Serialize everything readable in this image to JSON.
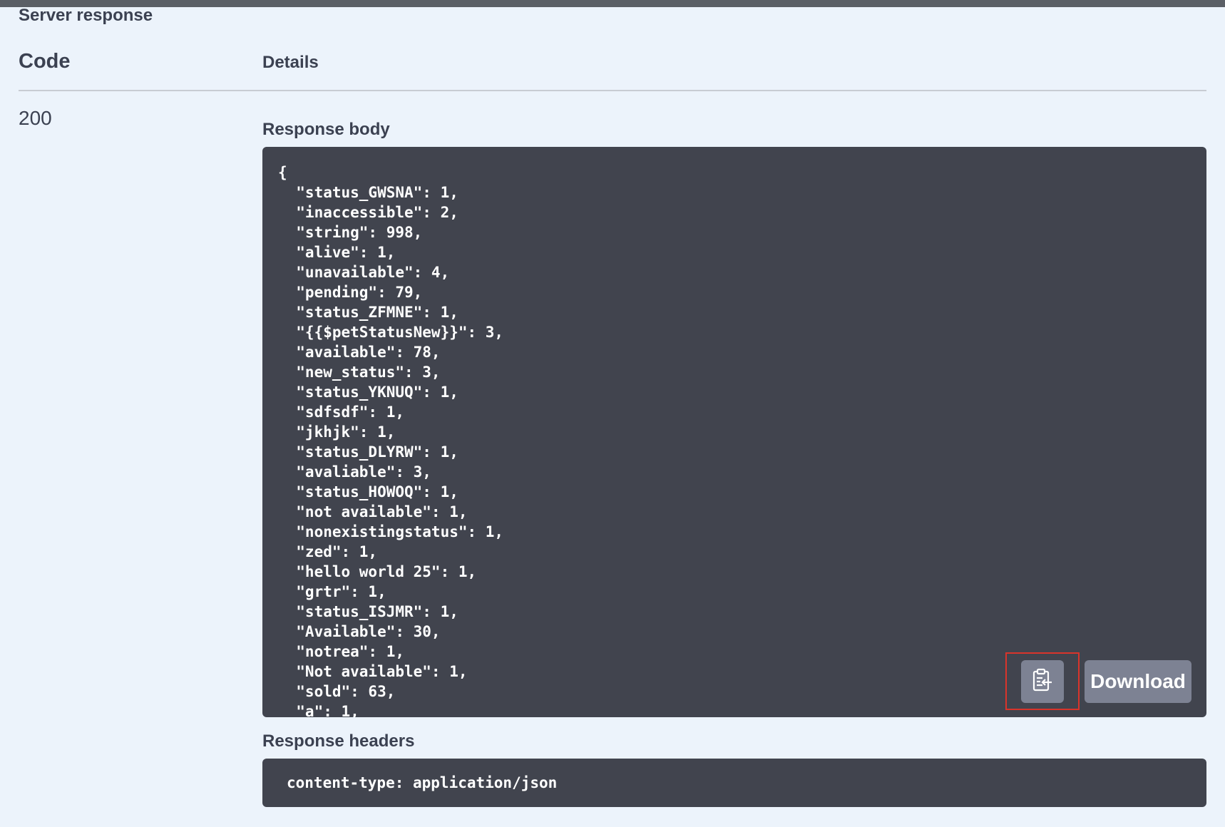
{
  "section": {
    "title": "Server response"
  },
  "table": {
    "code_header": "Code",
    "details_header": "Details",
    "code_value": "200"
  },
  "response_body": {
    "label": "Response body",
    "content": "{\n  \"status_GWSNA\": 1,\n  \"inaccessible\": 2,\n  \"string\": 998,\n  \"alive\": 1,\n  \"unavailable\": 4,\n  \"pending\": 79,\n  \"status_ZFMNE\": 1,\n  \"{{$petStatusNew}}\": 3,\n  \"available\": 78,\n  \"new_status\": 3,\n  \"status_YKNUQ\": 1,\n  \"sdfsdf\": 1,\n  \"jkhjk\": 1,\n  \"status_DLYRW\": 1,\n  \"avaliable\": 3,\n  \"status_HOWOQ\": 1,\n  \"not available\": 1,\n  \"nonexistingstatus\": 1,\n  \"zed\": 1,\n  \"hello world 25\": 1,\n  \"grtr\": 1,\n  \"status_ISJMR\": 1,\n  \"Available\": 30,\n  \"notrea\": 1,\n  \"Not available\": 1,\n  \"sold\": 63,\n  \"a\": 1,",
    "copy_icon": "clipboard-copy-icon",
    "download_label": "Download"
  },
  "response_headers": {
    "label": "Response headers",
    "content": "content-type: application/json"
  },
  "colors": {
    "background": "#ecf3fb",
    "code_block": "#41444e",
    "button": "#7d8293",
    "highlight": "#d9342b"
  }
}
